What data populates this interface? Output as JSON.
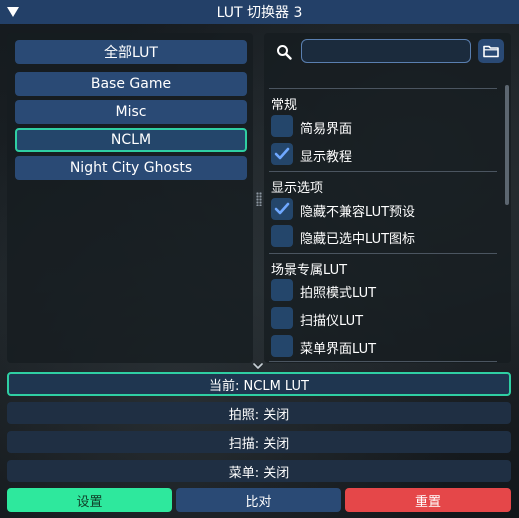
{
  "window": {
    "title": "LUT 切换器 3"
  },
  "categories": {
    "all": "全部LUT",
    "items": [
      {
        "label": "Base Game",
        "active": false
      },
      {
        "label": "Misc",
        "active": false
      },
      {
        "label": "NCLM",
        "active": true
      },
      {
        "label": "Night City Ghosts",
        "active": false
      }
    ]
  },
  "search": {
    "value": "",
    "placeholder": ""
  },
  "options": {
    "general": {
      "header": "常规",
      "simple_ui": {
        "label": "简易界面",
        "checked": false
      },
      "show_tutorial": {
        "label": "显示教程",
        "checked": true
      }
    },
    "display": {
      "header": "显示选项",
      "hide_incompatible": {
        "label": "隐藏不兼容LUT预设",
        "checked": true
      },
      "hide_selected_icon": {
        "label": "隐藏已选中LUT图标",
        "checked": false
      }
    },
    "scene": {
      "header": "场景专属LUT",
      "photo_mode": {
        "label": "拍照模式LUT",
        "checked": false
      },
      "scanner": {
        "label": "扫描仪LUT",
        "checked": false
      },
      "menu_ui": {
        "label": "菜单界面LUT",
        "checked": false
      }
    }
  },
  "status": {
    "current": "当前: NCLM LUT",
    "photo": "拍照: 关闭",
    "scan": "扫描: 关闭",
    "menu": "菜单: 关闭"
  },
  "actions": {
    "settings": "设置",
    "compare": "比对",
    "reset": "重置"
  },
  "colors": {
    "accent": "#2fcfa3",
    "button": "#2a4a75",
    "settings": "#2ee89d",
    "reset": "#e54749",
    "titlebar": "#234068"
  }
}
